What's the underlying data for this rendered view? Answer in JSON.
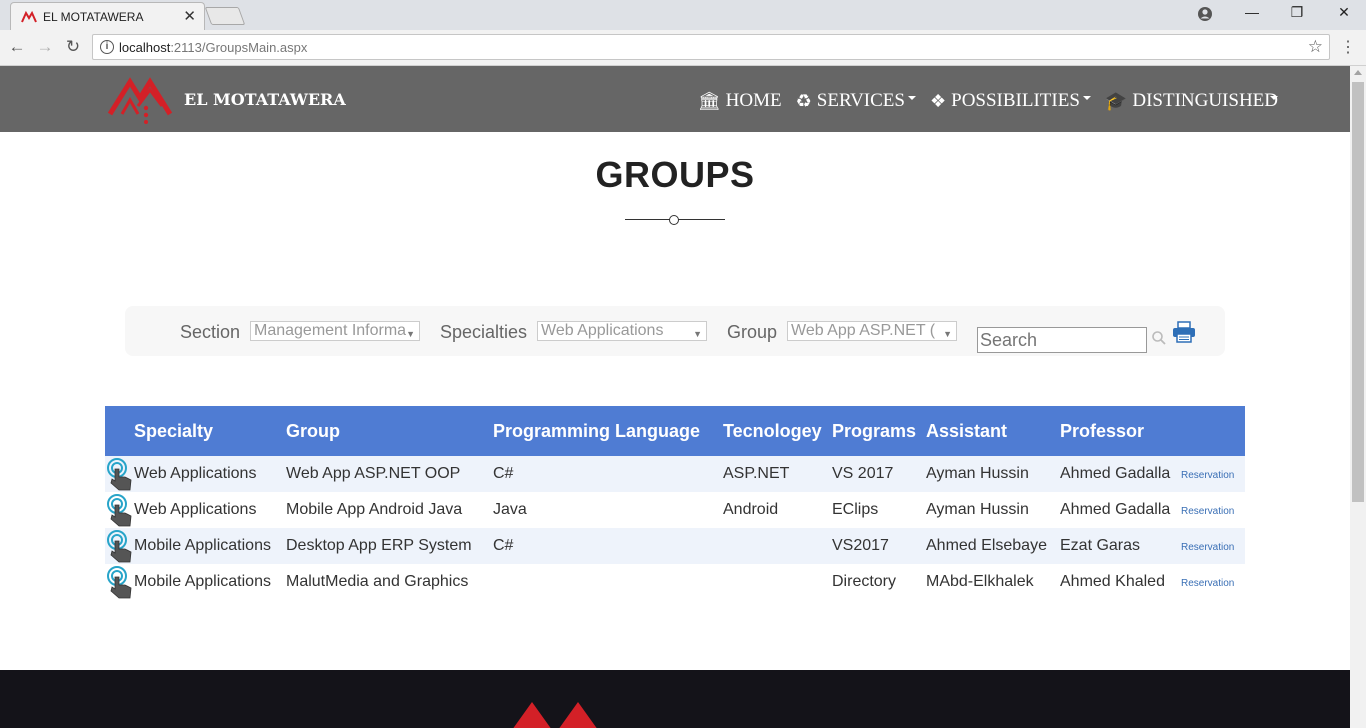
{
  "browser": {
    "tab_title": "EL MOTATAWERA",
    "url_host": "localhost",
    "url_path": ":2113/GroupsMain.aspx",
    "close_glyph": "✕",
    "window_controls": {
      "minimize": "—",
      "restore": "❐",
      "close": "✕"
    }
  },
  "site": {
    "logo_text": "EL MOTATAWERA",
    "nav": [
      {
        "label": "HOME",
        "icon": "bank-icon",
        "glyph": "🏛",
        "has_caret": false
      },
      {
        "label": "SERVICES",
        "icon": "recycle-icon",
        "glyph": "♻",
        "has_caret": true
      },
      {
        "label": "POSSIBILITIES",
        "icon": "cubes-icon",
        "glyph": "❖",
        "has_caret": true
      },
      {
        "label": "DISTINGUISHED",
        "icon": "graduation-cap-icon",
        "glyph": "🎓",
        "has_caret": false
      }
    ]
  },
  "page": {
    "title": "GROUPS"
  },
  "filters": {
    "section_label": "Section",
    "section_value": "Management Informa",
    "specialties_label": "Specialties",
    "specialties_value": "Web Applications",
    "group_label": "Group",
    "group_value": "Web App ASP.NET (",
    "search_placeholder": "Search"
  },
  "table": {
    "headers": [
      "Specialty",
      "Group",
      "Programming Language",
      "Tecnologey",
      "Programs",
      "Assistant",
      "Professor"
    ],
    "rows": [
      {
        "specialty": "Web Applications",
        "group": "Web App ASP.NET OOP",
        "language": "C#",
        "technology": "ASP.NET",
        "programs": "VS 2017",
        "assistant": "Ayman Hussin",
        "professor": "Ahmed Gadalla",
        "action": "Reservation"
      },
      {
        "specialty": "Web Applications",
        "group": "Mobile App Android Java",
        "language": "Java",
        "technology": "Android",
        "programs": "EClips",
        "assistant": "Ayman Hussin",
        "professor": "Ahmed Gadalla",
        "action": "Reservation"
      },
      {
        "specialty": "Mobile Applications",
        "group": "Desktop App ERP System",
        "language": "C#",
        "technology": "",
        "programs": "VS2017",
        "assistant": "Ahmed Elsebaye",
        "professor": "Ezat Garas",
        "action": "Reservation"
      },
      {
        "specialty": "Mobile Applications",
        "group": "MalutMedia and Graphics",
        "language": "",
        "technology": "",
        "programs": "Directory",
        "assistant": "MAbd-Elkhalek",
        "professor": "Ahmed Khaled",
        "action": "Reservation"
      }
    ]
  },
  "colors": {
    "header_bg": "#666666",
    "table_header": "#4f7cd3",
    "brand_red": "#d32027",
    "footer_bg": "#141319"
  }
}
